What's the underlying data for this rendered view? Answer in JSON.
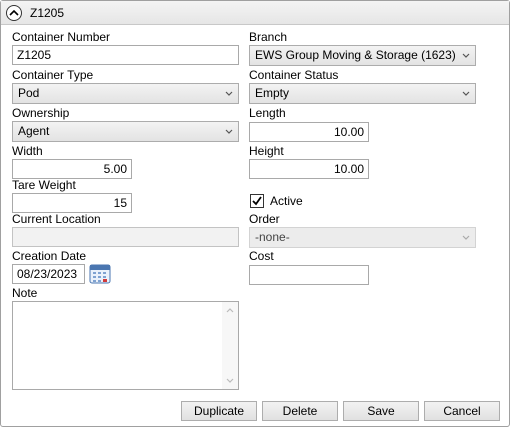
{
  "header": {
    "title": "Z1205"
  },
  "fields": {
    "container_number": {
      "label": "Container Number",
      "value": "Z1205"
    },
    "branch": {
      "label": "Branch",
      "value": "EWS Group Moving & Storage (1623)"
    },
    "container_type": {
      "label": "Container Type",
      "value": "Pod"
    },
    "container_status": {
      "label": "Container Status",
      "value": "Empty"
    },
    "ownership": {
      "label": "Ownership",
      "value": "Agent"
    },
    "length": {
      "label": "Length",
      "value": "10.00"
    },
    "width": {
      "label": "Width",
      "value": "5.00"
    },
    "height": {
      "label": "Height",
      "value": "10.00"
    },
    "tare_weight": {
      "label": "Tare Weight",
      "value": "15"
    },
    "active": {
      "label": "Active",
      "checked": true
    },
    "current_location": {
      "label": "Current Location",
      "value": ""
    },
    "order": {
      "label": "Order",
      "value": "-none-"
    },
    "creation_date": {
      "label": "Creation Date",
      "value": "08/23/2023"
    },
    "cost": {
      "label": "Cost",
      "value": ""
    },
    "note": {
      "label": "Note",
      "value": ""
    }
  },
  "buttons": {
    "duplicate": "Duplicate",
    "delete": "Delete",
    "save": "Save",
    "cancel": "Cancel"
  },
  "icons": {
    "collapse": "chevron-up-icon",
    "calendar": "calendar-icon",
    "dropdown": "chevron-down-icon",
    "check": "checkmark-icon"
  }
}
